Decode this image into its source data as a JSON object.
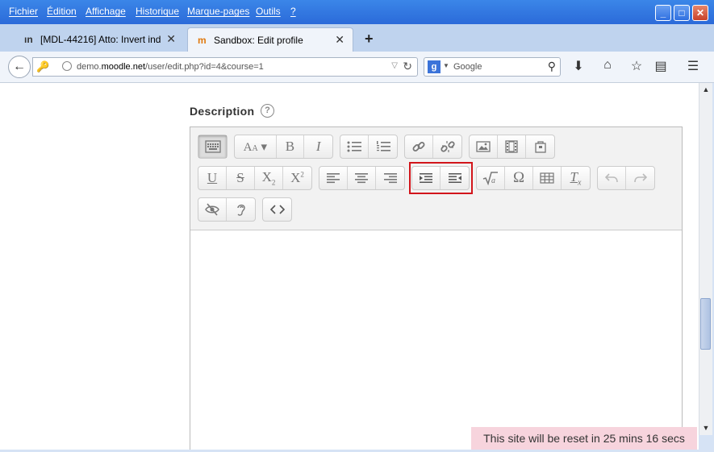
{
  "menubar": {
    "items": [
      "Fichier",
      "Édition",
      "Affichage",
      "Historique",
      "Marque-pages",
      "Outils",
      "?"
    ]
  },
  "tabs": [
    {
      "label": "[MDL-44216] Atto: Invert ind...",
      "active": false
    },
    {
      "label": "Sandbox: Edit profile",
      "active": true
    }
  ],
  "navbar": {
    "url_prefix": "demo.",
    "url_domain": "moodle.net",
    "url_path": "/user/edit.php?id=4&course=1",
    "search_placeholder": "Google",
    "search_engine_letter": "g"
  },
  "page": {
    "section_label": "Description",
    "help_icon": "?"
  },
  "toolbar_rows": [
    [
      {
        "group": "toggle",
        "buttons": [
          "toolbar-toggle"
        ]
      },
      {
        "group": "font",
        "buttons": [
          "font-size",
          "bold",
          "italic"
        ]
      },
      {
        "group": "lists",
        "buttons": [
          "unordered-list",
          "ordered-list"
        ]
      },
      {
        "group": "links",
        "buttons": [
          "link",
          "unlink"
        ]
      },
      {
        "group": "media",
        "buttons": [
          "image",
          "media",
          "manage-files"
        ]
      }
    ],
    [
      {
        "group": "format",
        "buttons": [
          "underline",
          "strikethrough",
          "subscript",
          "superscript"
        ]
      },
      {
        "group": "align",
        "buttons": [
          "align-left",
          "align-center",
          "align-right"
        ]
      },
      {
        "group": "indent",
        "buttons": [
          "indent",
          "outdent"
        ]
      },
      {
        "group": "insert",
        "buttons": [
          "equation",
          "special-char",
          "table",
          "clear-format"
        ]
      },
      {
        "group": "history",
        "buttons": [
          "undo",
          "redo"
        ]
      }
    ],
    [
      {
        "group": "accessibility",
        "buttons": [
          "accessibility-checker",
          "screenreader-helper"
        ]
      },
      {
        "group": "html",
        "buttons": [
          "html-source"
        ]
      }
    ]
  ],
  "glyphs": {
    "bold": "B",
    "italic": "I",
    "underline": "U",
    "strikethrough": "S",
    "subscript_base": "X",
    "subscript_mark": "2",
    "superscript_base": "X",
    "superscript_mark": "2",
    "omega": "Ω",
    "clear_format_base": "T",
    "clear_format_mark": "x",
    "font_a": "A",
    "html": "<>"
  },
  "reset_banner": "This site will be reset in 25 mins 16 secs"
}
